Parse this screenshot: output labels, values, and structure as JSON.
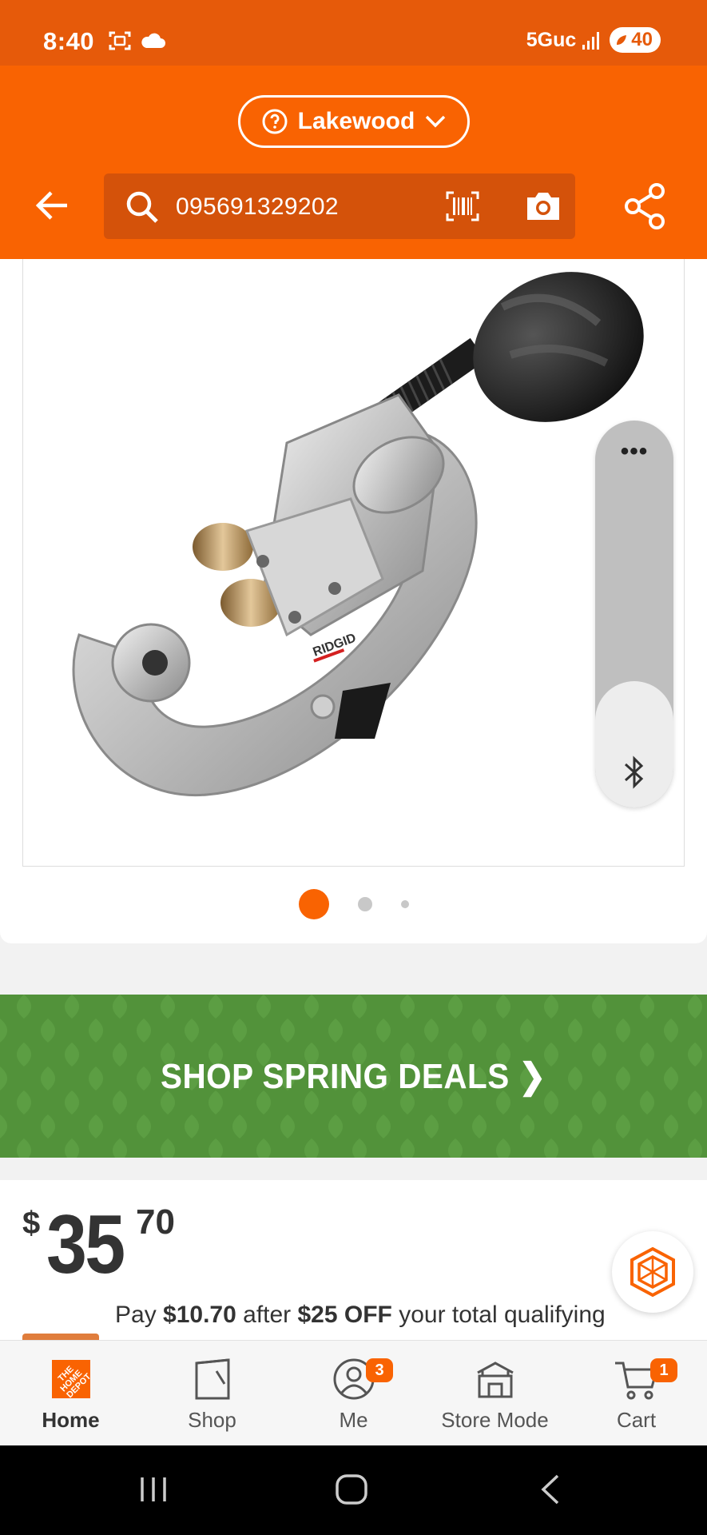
{
  "status_bar": {
    "time": "8:40",
    "network": "5Guc",
    "battery": "40"
  },
  "header": {
    "store_name": "Lakewood",
    "search_query": "095691329202"
  },
  "product": {
    "image_alt": "RIDGID tubing cutter",
    "brand_mark": "RIDGID",
    "carousel": {
      "total_images": 3,
      "active_index": 0
    }
  },
  "promo": {
    "label": "SHOP SPRING DEALS ❯"
  },
  "price": {
    "currency": "$",
    "dollars": "35",
    "cents": "70"
  },
  "offer": {
    "prefix": "Pay ",
    "amount": "$10.70",
    "middle": " after ",
    "discount": "$25 OFF",
    "suffix": " your total qualifying"
  },
  "bottom_nav": {
    "items": [
      {
        "label": "Home",
        "icon": "home-depot-logo-icon",
        "active": true
      },
      {
        "label": "Shop",
        "icon": "shop-icon"
      },
      {
        "label": "Me",
        "icon": "account-icon",
        "badge": "3"
      },
      {
        "label": "Store Mode",
        "icon": "store-icon"
      },
      {
        "label": "Cart",
        "icon": "cart-icon",
        "badge": "1"
      }
    ]
  },
  "colors": {
    "brand_orange": "#f96302",
    "status_bar": "#e65a0a",
    "search_bg": "#d4520a",
    "promo_green": "#52923a"
  }
}
